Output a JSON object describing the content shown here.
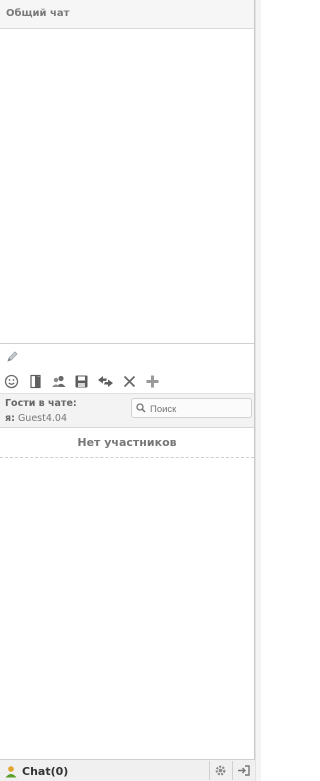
{
  "header": {
    "title": "Общий чат"
  },
  "input": {
    "placeholder": ""
  },
  "toolbar": {
    "buttons": [
      "smiley-icon",
      "exit-door-icon",
      "users-icon",
      "save-icon",
      "refresh-icon",
      "close-icon",
      "add-icon"
    ]
  },
  "guests": {
    "title": "Гости в чате:",
    "me_label": "я:",
    "me_name": "Guest4.04"
  },
  "search": {
    "placeholder": "Поиск"
  },
  "participants": {
    "empty_text": "Нет участников"
  },
  "bottom": {
    "chat_tab_label": "Chat(0)",
    "settings_icon": "gear-icon",
    "logout_icon": "logout-icon"
  },
  "colors": {
    "border": "#cfcfcf",
    "header_bg": "#f6f6f6",
    "accent_green": "#5aa02c"
  }
}
